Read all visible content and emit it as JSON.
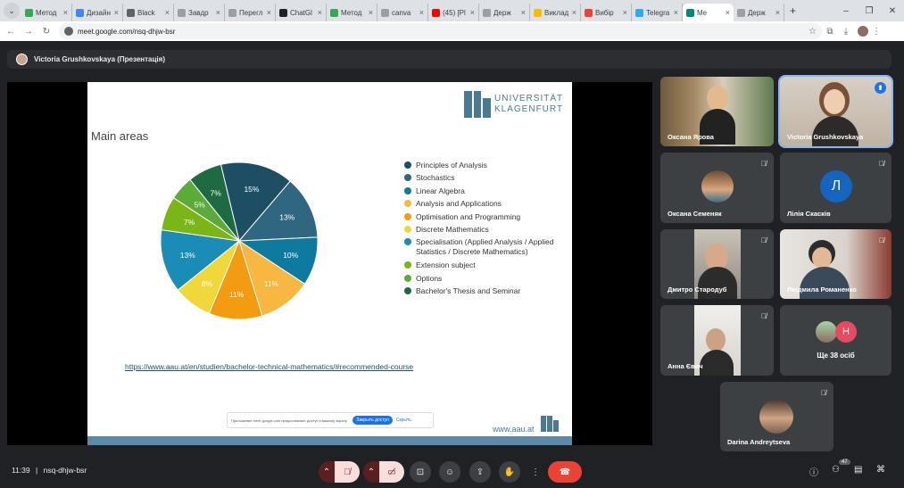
{
  "browser": {
    "tabs": [
      {
        "label": "Метод",
        "color": "#34a853"
      },
      {
        "label": "Дизайн",
        "color": "#4285f4"
      },
      {
        "label": "Black",
        "color": "#5f6368"
      },
      {
        "label": "Завдр",
        "color": "#9aa0a6"
      },
      {
        "label": "Перегл",
        "color": "#9aa0a6"
      },
      {
        "label": "ChatGl",
        "color": "#202124"
      },
      {
        "label": "Метод",
        "color": "#34a853"
      },
      {
        "label": "canva",
        "color": "#9aa0a6"
      },
      {
        "label": "(45) [Pl",
        "color": "#ff0000"
      },
      {
        "label": "Держ",
        "color": "#9aa0a6"
      },
      {
        "label": "Виклад",
        "color": "#fbbc04"
      },
      {
        "label": "Вибір",
        "color": "#ea4335"
      },
      {
        "label": "Telegra",
        "color": "#2aabee"
      },
      {
        "label": "Me",
        "color": "#00897b",
        "active": true
      },
      {
        "label": "Держ",
        "color": "#9aa0a6"
      }
    ],
    "url": "meet.google.com/nsq-dhjw-bsr"
  },
  "presenter": {
    "name": "Victoria Grushkovskaya (Презентація)"
  },
  "slide": {
    "title": "Main areas",
    "logo_line1": "UNIVERSITÄT",
    "logo_line2": "KLAGENFURT",
    "link": "https://www.aau.at/en/studien/bachelor-technical-mathematics/#recommended-course",
    "footer_url": "www.aau.at",
    "share_notice": "Приложение meet.google.com предоставляет доступ к вашему экрану.",
    "share_stop": "Закрыть доступ",
    "share_hide": "Скрыть"
  },
  "chart_data": {
    "type": "pie",
    "title": "Main areas",
    "categories": [
      "Principles of Analysis",
      "Stochastics",
      "Linear Algebra",
      "Analysis and Applications",
      "Optimisation and Programming",
      "Discrete Mathematics",
      "Specialisation (Applied Analysis / Applied Statistics / Discrete Mathematics)",
      "Extension subject",
      "Options",
      "Bachelor's Thesis and Seminar"
    ],
    "values": [
      15,
      13,
      10,
      11,
      11,
      8,
      13,
      7,
      5,
      7
    ],
    "labels": [
      "15%",
      "13%",
      "10%",
      "11%",
      "11%",
      "8%",
      "13%",
      "7%",
      "5%",
      "7%"
    ],
    "colors": [
      "#1d4e63",
      "#2f6680",
      "#0e7aa0",
      "#f7b740",
      "#f39c12",
      "#f0d83a",
      "#1a8cb5",
      "#7cb518",
      "#5aab3a",
      "#1e6b43"
    ],
    "legend_position": "right",
    "legend_lines": [
      [
        "Principles of Analysis"
      ],
      [
        "Stochastics"
      ],
      [
        "Linear Algebra"
      ],
      [
        "Analysis and Applications"
      ],
      [
        "Optimisation and Programming"
      ],
      [
        "Discrete Mathematics"
      ],
      [
        "Specialisation (Applied Analysis / Applied",
        "Statistics / Discrete Mathematics)"
      ],
      [
        "Extension subject"
      ],
      [
        "Options"
      ],
      [
        "Bachelor's Thesis and Seminar"
      ]
    ]
  },
  "participants": [
    {
      "name": "Оксана Ярова",
      "muted": false
    },
    {
      "name": "Victoria Grushkovskaya",
      "muted": false,
      "speaking": true
    },
    {
      "name": "Оксана Семеняк",
      "muted": true
    },
    {
      "name": "Лілія Скасків",
      "muted": true,
      "initial": "Л",
      "avatar_color": "#1565c0"
    },
    {
      "name": "Дмитро Стародуб",
      "muted": true
    },
    {
      "name": "Людмила Романенко",
      "muted": true
    },
    {
      "name": "Анна Євич",
      "muted": true
    },
    {
      "name": "Darina Andreytseva",
      "muted": true
    }
  ],
  "others": {
    "label": "Ще 38 осіб",
    "initial": "H",
    "avatar_color": "#e84a5f"
  },
  "bottom": {
    "time": "11:39",
    "separator": "|",
    "meeting_code": "nsq-dhjw-bsr",
    "people_count": "47"
  }
}
